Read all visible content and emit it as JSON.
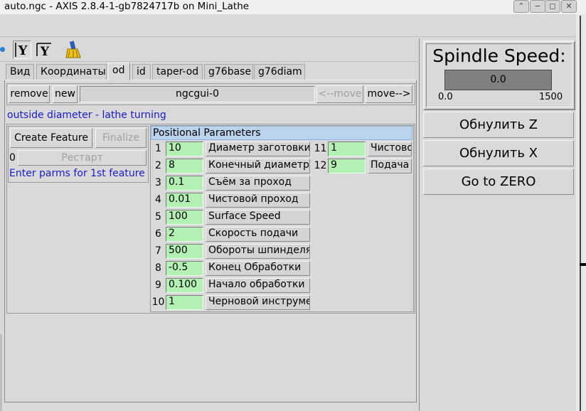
{
  "window": {
    "title": "auto.ngc - AXIS 2.8.4-1-gb7824717b on Mini_Lathe",
    "buttons": [
      {
        "icon": "chevron-up-icon",
        "glyph": "⌃"
      },
      {
        "icon": "minimize-icon",
        "glyph": "−"
      },
      {
        "icon": "maximize-icon",
        "glyph": "◻"
      },
      {
        "icon": "close-icon",
        "glyph": "✕"
      }
    ]
  },
  "toolbar": {
    "icons": [
      "view-y-icon",
      "view-rotated-y-icon",
      "clear-backplot-icon"
    ],
    "y_glyph": "Y",
    "y_rot_glyph": "Y"
  },
  "tabs": [
    "Вид",
    "Координаты",
    "od",
    "id",
    "taper-od",
    "g76base",
    "g76diam"
  ],
  "active_tab": "od",
  "ngcgui": {
    "remove_label": "remove",
    "new_label": "new",
    "page_name": "ngcgui-0",
    "move_left_label": "<--move",
    "move_right_label": "move-->",
    "description": "outside diameter - lathe turning",
    "create_feature_label": "Create Feature",
    "finalize_label": "Finalize",
    "restart_count": "0",
    "restart_label": "Рестарт",
    "hint": "Enter parms for 1st feature",
    "params_title": "Positional Parameters",
    "params": [
      {
        "num": "1",
        "value": "10",
        "label": "Диаметр заготовки"
      },
      {
        "num": "2",
        "value": "8",
        "label": "Конечный диаметр"
      },
      {
        "num": "3",
        "value": "0.1",
        "label": "Съём за проход"
      },
      {
        "num": "4",
        "value": "0.01",
        "label": "Чистовой проход"
      },
      {
        "num": "5",
        "value": "100",
        "label": "Surface Speed"
      },
      {
        "num": "6",
        "value": "2",
        "label": "Скорость подачи"
      },
      {
        "num": "7",
        "value": "500",
        "label": "Обороты шпинделя"
      },
      {
        "num": "8",
        "value": "-0.5",
        "label": "Конец Обработки"
      },
      {
        "num": "9",
        "value": "0.100",
        "label": "Начало обработки"
      },
      {
        "num": "10",
        "value": "1",
        "label": "Черновой инструмент"
      }
    ],
    "params2": [
      {
        "num": "11",
        "value": "1",
        "label": "Чистовой"
      },
      {
        "num": "12",
        "value": "9",
        "label": "Подача С"
      }
    ]
  },
  "spindle": {
    "title": "Spindle Speed:",
    "value": "0.0",
    "scale_min": "0.0",
    "scale_max": "1500",
    "fraction": 0.0
  },
  "actions": {
    "zero_z": "Обнулить Z",
    "zero_x": "Обнулить X",
    "go_zero": "Go to ZERO"
  },
  "colors": {
    "entry_bg": "#b3f0b3",
    "params_header_bg": "#bcd3ee",
    "description_text": "#1a1acc",
    "bar_fill": "#808080"
  }
}
